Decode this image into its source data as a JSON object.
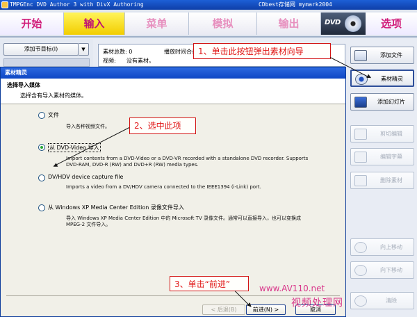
{
  "titlebar": {
    "title": "TMPGEnc DVD Author 3 with DivX Authoring",
    "right_text": "CDbest存储网 mymark2004"
  },
  "tabs": [
    {
      "label": "开始",
      "state": "active"
    },
    {
      "label": "输入",
      "state": "current"
    },
    {
      "label": "菜单",
      "state": "inactive"
    },
    {
      "label": "模拟",
      "state": "inactive"
    },
    {
      "label": "输出",
      "state": "inactive"
    },
    {
      "label": "选项",
      "state": "active"
    }
  ],
  "dvd_logo": "DVD",
  "left_panel": {
    "add_title_button": "添加节目标(I)",
    "dropdown_glyph": "▼"
  },
  "info_panel": {
    "total_label": "素材总数: 0",
    "duration_label": "播放时间合计: 0 秒",
    "video_label": "视频:",
    "video_value": "没有素材。"
  },
  "right_buttons": {
    "add_file": "添加文件",
    "source_wizard": "素材精灵",
    "add_slideshow": "添加幻灯片",
    "cut_edit": "剪切编辑",
    "edit_subtitle": "编辑字幕",
    "delete_source": "删除素材",
    "move_up": "向上移动",
    "move_down": "向下移动",
    "clear": "清除"
  },
  "dialog": {
    "title": "素材精灵",
    "heading": "选择导入媒体",
    "subheading": "选择含有导入素材的媒体。",
    "options": [
      {
        "label": "文件",
        "desc": "导入各种视频文件。",
        "checked": false
      },
      {
        "label": "从 DVD-Video 导入",
        "desc": "Import contents from a DVD-Video or a DVD-VR recorded with a standalone DVD recorder. Supports DVD-RAM, DVD-R (RW) and DVD+R (RW) media types.",
        "checked": true
      },
      {
        "label": "DV/HDV device capture file",
        "desc": "Imports a video from a DV/HDV camera connected to the IEEE1394 (i-Link) port.",
        "checked": false
      },
      {
        "label": "从 Windows XP Media Center Edition 录像文件导入",
        "desc": "导入 Windows XP Media Center Edition 中的 Microsoft TV 录像文件。通常可以直接导入，也可以变换成 MPEG-2 文件导入。",
        "checked": false
      }
    ],
    "back_button": "< 后退(B)",
    "next_button": "前进(N) >",
    "cancel_button": "取消"
  },
  "annotations": {
    "callout_1": "1、单击此按钮弹出素材向导",
    "callout_2": "2、选中此项",
    "callout_3": "3、单击“前进”"
  },
  "watermark": {
    "url": "www.AV110.net",
    "text": "视频处理网"
  },
  "colors": {
    "titlebar": "#1d5fd6",
    "current_tab": "#f2cd00",
    "tab_text_active": "#d11d7a",
    "callout_red": "#e01414",
    "watermark": "#d9368a"
  }
}
